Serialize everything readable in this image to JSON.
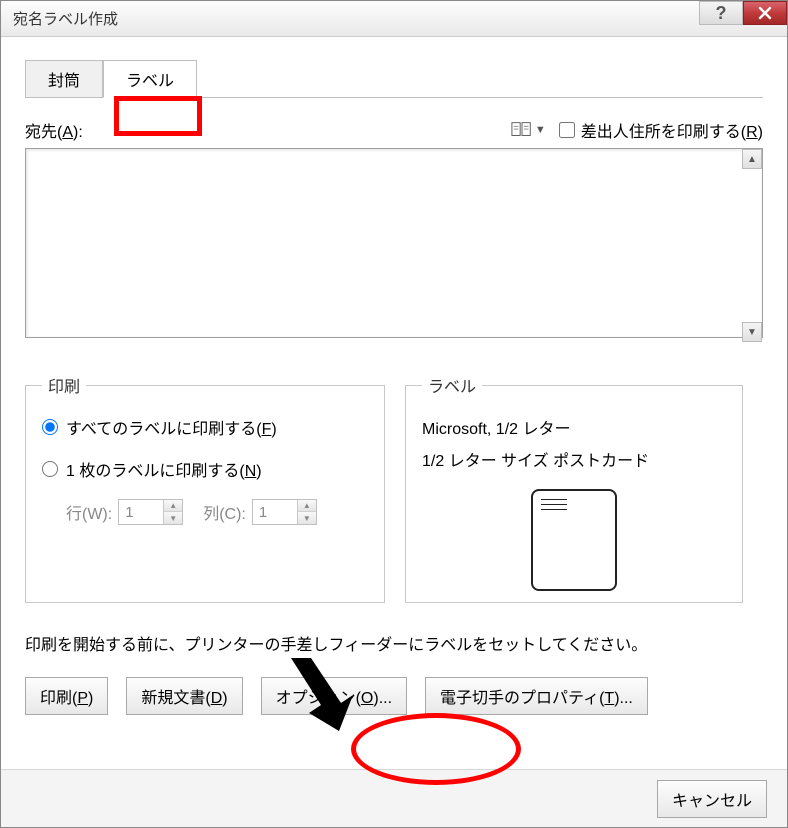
{
  "titlebar": {
    "title": "宛名ラベル作成"
  },
  "tabs": {
    "envelope": "封筒",
    "label": "ラベル"
  },
  "address": {
    "label_prefix": "宛先(",
    "label_key": "A",
    "label_suffix": "):",
    "sender_prefix": "差出人住所を印刷する(",
    "sender_key": "R",
    "sender_suffix": ")",
    "value": ""
  },
  "print_group": {
    "legend": "印刷",
    "opt_all_prefix": "すべてのラベルに印刷する(",
    "opt_all_key": "F",
    "opt_all_suffix": ")",
    "opt_one_prefix": "1 枚のラベルに印刷する(",
    "opt_one_key": "N",
    "opt_one_suffix": ")",
    "row_label": "行(W):",
    "row_value": "1",
    "col_label": "列(C):",
    "col_value": "1"
  },
  "label_group": {
    "legend": "ラベル",
    "vendor": "Microsoft, 1/2 レター",
    "product": "1/2 レター サイズ ポストカード"
  },
  "instruction": "印刷を開始する前に、プリンターの手差しフィーダーにラベルをセットしてください。",
  "buttons": {
    "print_prefix": "印刷(",
    "print_key": "P",
    "print_suffix": ")",
    "newdoc_prefix": "新規文書(",
    "newdoc_key": "D",
    "newdoc_suffix": ")",
    "options_prefix": "オプション(",
    "options_key": "O",
    "options_suffix": ")...",
    "props_prefix": "電子切手のプロパティ(",
    "props_key": "T",
    "props_suffix": ")...",
    "cancel": "キャンセル"
  }
}
